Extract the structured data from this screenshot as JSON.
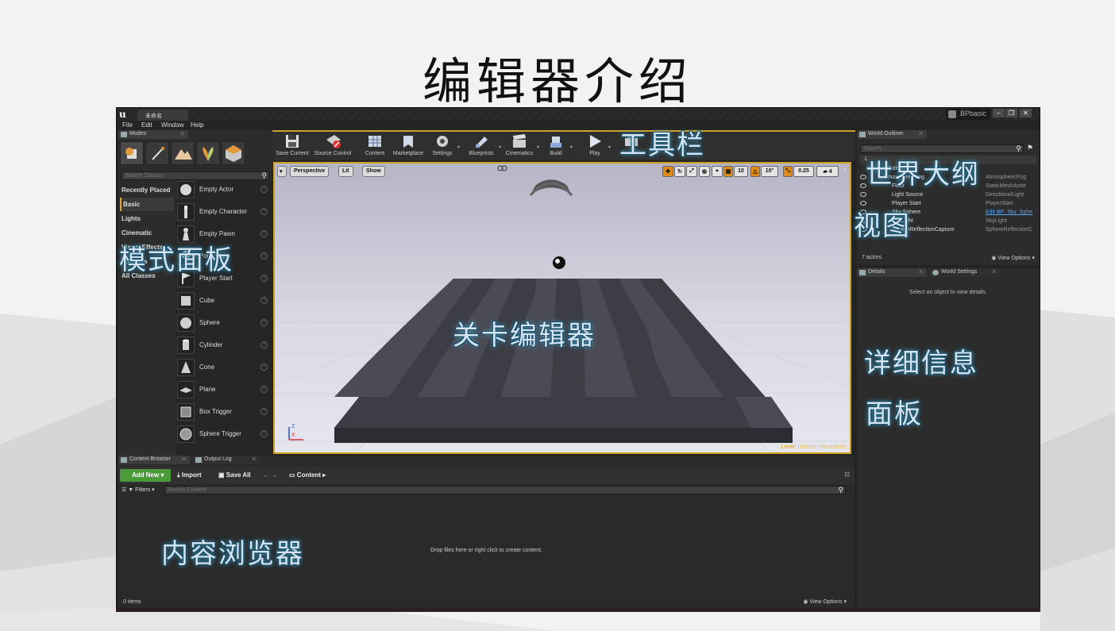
{
  "slide": {
    "title": "编辑器介绍"
  },
  "window": {
    "doc_tab": "未命名",
    "project": "BPbasic",
    "controls": [
      "–",
      "❐",
      "✕"
    ]
  },
  "menu": [
    "File",
    "Edit",
    "Window",
    "Help"
  ],
  "modes": {
    "tab": "Modes",
    "search_placeholder": "Search Classes",
    "categories": [
      "Recently Placed",
      "Basic",
      "Lights",
      "Cinematic",
      "Visual Effects",
      "Volumes",
      "All Classes"
    ],
    "active_category": "Basic",
    "items": [
      {
        "label": "Empty Actor",
        "icon": "sphere-icon"
      },
      {
        "label": "Empty Character",
        "icon": "character-icon"
      },
      {
        "label": "Empty Pawn",
        "icon": "pawn-icon"
      },
      {
        "label": "Point Light",
        "icon": "light-bulb-icon"
      },
      {
        "label": "Player Start",
        "icon": "flag-icon"
      },
      {
        "label": "Cube",
        "icon": "cube-icon"
      },
      {
        "label": "Sphere",
        "icon": "sphere-icon"
      },
      {
        "label": "Cylinder",
        "icon": "cylinder-icon"
      },
      {
        "label": "Cone",
        "icon": "cone-icon"
      },
      {
        "label": "Plane",
        "icon": "plane-icon"
      },
      {
        "label": "Box Trigger",
        "icon": "box-trigger-icon"
      },
      {
        "label": "Sphere Trigger",
        "icon": "sphere-trigger-icon"
      }
    ]
  },
  "toolbar": {
    "buttons": [
      "Save Current",
      "Source Control",
      "Content",
      "Marketplace",
      "Settings",
      "Blueprints",
      "Cinematics",
      "Build",
      "Play",
      "Launch"
    ]
  },
  "viewport": {
    "perspective": "Perspective",
    "lit": "Lit",
    "show": "Show",
    "grid_snap": "10",
    "rot_snap": "10°",
    "scale_snap": "0.25",
    "camera_speed": "4",
    "level_prefix": "Level:",
    "level_name": "Untitled (Persistent)",
    "axis": {
      "z": "Z",
      "x": "X"
    }
  },
  "outliner": {
    "tab": "World Outliner",
    "search_placeholder": "Search...",
    "label_header": "L",
    "rows": [
      {
        "name": "Untitled (Editor)",
        "type": ""
      },
      {
        "name": "Atmospheric Fog",
        "type": "AtmosphericFog",
        "link": false
      },
      {
        "name": "Floor",
        "type": "StaticMeshActor",
        "link": false
      },
      {
        "name": "Light Source",
        "type": "DirectionalLight",
        "link": false
      },
      {
        "name": "Player Start",
        "type": "PlayerStart",
        "link": false
      },
      {
        "name": "Sky Sphere",
        "type": "Edit BP_Sky_Sphe",
        "link": true
      },
      {
        "name": "SkyLight",
        "type": "SkyLight",
        "link": false
      },
      {
        "name": "SphereReflectionCapture",
        "type": "SphereReflectionC",
        "link": false
      }
    ],
    "count": "7 actors",
    "view_options": "View Options"
  },
  "details": {
    "tab": "Details",
    "tab2": "World Settings",
    "empty_msg": "Select an object to view details."
  },
  "content_browser": {
    "tab": "Content Browser",
    "tab2": "Output Log",
    "add_new": "Add New",
    "import": "Import",
    "save_all": "Save All",
    "path": "Content",
    "filters": "Filters",
    "search_placeholder": "Search Content",
    "empty_msg": "Drop files here or right click to create content.",
    "items": "0 items",
    "view_options": "View Options"
  },
  "annotations": {
    "toolbar": "工具栏",
    "outliner_1": "世界大纲",
    "outliner_2": "视图",
    "modes": "模式面板",
    "level_editor": "关卡编辑器",
    "details_1": "详细信息",
    "details_2": "面板",
    "content_browser": "内容浏览器"
  }
}
